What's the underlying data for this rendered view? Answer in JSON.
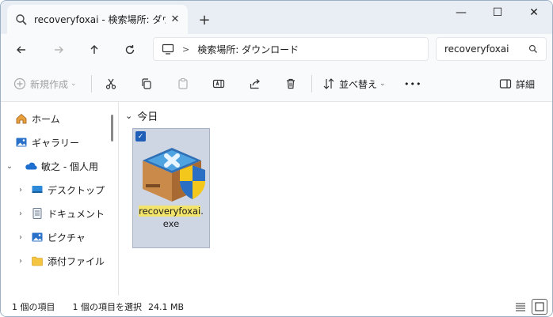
{
  "tab": {
    "title": "recoveryfoxai - 検索場所: ダウン",
    "close": "✕"
  },
  "window_controls": {
    "minimize": "—",
    "maximize": "☐",
    "close": "✕"
  },
  "address": {
    "path": "検索場所: ダウンロード",
    "separator": ">"
  },
  "search": {
    "value": "recoveryfoxai"
  },
  "command_bar": {
    "new_label": "新規作成",
    "sort_label": "並べ替え",
    "more_label": "•••",
    "details_label": "詳細"
  },
  "nav_pane": {
    "items": [
      {
        "label": "ホーム",
        "icon": "home-icon"
      },
      {
        "label": "ギャラリー",
        "icon": "gallery-icon"
      },
      {
        "label": "敏之 - 個人用",
        "icon": "onedrive-icon"
      },
      {
        "label": "デスクトップ",
        "icon": "desktop-icon"
      },
      {
        "label": "ドキュメント",
        "icon": "document-icon"
      },
      {
        "label": "ピクチャ",
        "icon": "pictures-icon"
      },
      {
        "label": "添付ファイル",
        "icon": "folder-icon"
      }
    ]
  },
  "content": {
    "group_header": "今日",
    "file": {
      "name_highlight": "recoveryfoxai",
      "name_rest": ".",
      "ext": "exe"
    }
  },
  "status": {
    "item_count": "1 個の項目",
    "selected": "1 個の項目を選択",
    "size": "24.1 MB"
  },
  "colors": {
    "accent": "#1f5fb8",
    "selection": "#cfd6e3",
    "highlight": "#f2e36a"
  }
}
